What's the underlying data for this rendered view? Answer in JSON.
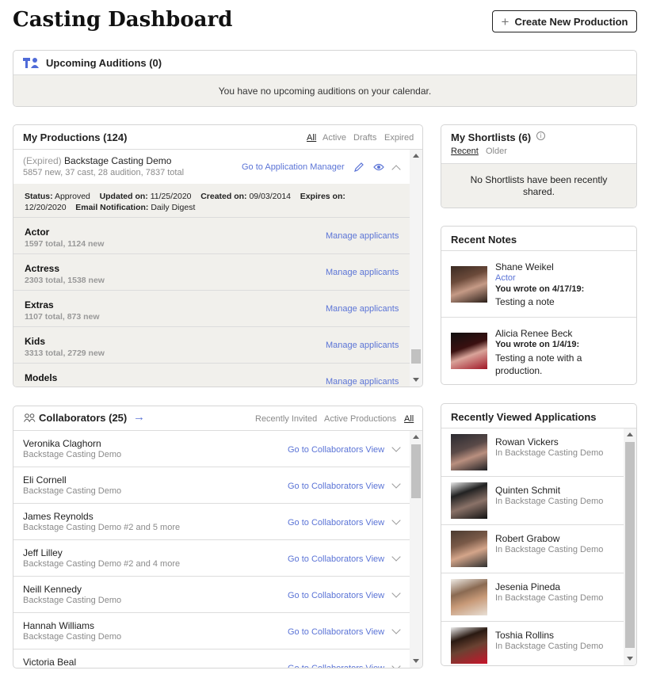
{
  "page": {
    "title": "Casting Dashboard",
    "create_btn": "Create New Production"
  },
  "auditions": {
    "title": "Upcoming Auditions (0)",
    "empty": "You have no upcoming auditions on your calendar."
  },
  "productions": {
    "title": "My Productions (124)",
    "filters": [
      "All",
      "Active",
      "Drafts",
      "Expired"
    ],
    "current": {
      "prefix": "(Expired)",
      "name": "Backstage Casting Demo",
      "stats": "5857 new, 37 cast, 28 audition, 7837 total",
      "app_link": "Go to Application Manager",
      "status_label": "Status:",
      "status": "Approved",
      "updated_label": "Updated on:",
      "updated": "11/25/2020",
      "created_label": "Created on:",
      "created": "09/03/2014",
      "expires_label": "Expires on:",
      "expires": "12/20/2020",
      "email_label": "Email Notification:",
      "email": "Daily Digest"
    },
    "roles": [
      {
        "name": "Actor",
        "stats": "1597 total, 1124 new",
        "link": "Manage applicants"
      },
      {
        "name": "Actress",
        "stats": "2303 total, 1538 new",
        "link": "Manage applicants"
      },
      {
        "name": "Extras",
        "stats": "1107 total, 873 new",
        "link": "Manage applicants"
      },
      {
        "name": "Kids",
        "stats": "3313 total, 2729 new",
        "link": "Manage applicants"
      },
      {
        "name": "Models",
        "stats": "",
        "link": "Manage applicants"
      }
    ]
  },
  "collaborators": {
    "title": "Collaborators (25)",
    "filters": [
      "Recently Invited",
      "Active Productions",
      "All"
    ],
    "items": [
      {
        "name": "Veronika Claghorn",
        "sub": "Backstage Casting Demo",
        "link": "Go to Collaborators View"
      },
      {
        "name": "Eli Cornell",
        "sub": "Backstage Casting Demo",
        "link": "Go to Collaborators View"
      },
      {
        "name": "James Reynolds",
        "sub": "Backstage Casting Demo #2 and 5 more",
        "link": "Go to Collaborators View"
      },
      {
        "name": "Jeff Lilley",
        "sub": "Backstage Casting Demo #2 and 4 more",
        "link": "Go to Collaborators View"
      },
      {
        "name": "Neill Kennedy",
        "sub": "Backstage Casting Demo",
        "link": "Go to Collaborators View"
      },
      {
        "name": "Hannah Williams",
        "sub": "Backstage Casting Demo",
        "link": "Go to Collaborators View"
      },
      {
        "name": "Victoria Beal",
        "sub": "",
        "link": "Go to Collaborators View"
      }
    ]
  },
  "shortlists": {
    "title": "My Shortlists (6)",
    "tabs": [
      "Recent",
      "Older"
    ],
    "empty": "No Shortlists have been recently shared."
  },
  "notes": {
    "title": "Recent Notes",
    "items": [
      {
        "name": "Shane Weikel",
        "role": "Actor",
        "wrote": "You wrote on 4/17/19:",
        "text": "Testing a note"
      },
      {
        "name": "Alicia Renee Beck",
        "role": "",
        "wrote": "You wrote on 1/4/19:",
        "text": "Testing a note with a production."
      }
    ]
  },
  "recent_apps": {
    "title": "Recently Viewed Applications",
    "items": [
      {
        "name": "Rowan Vickers",
        "sub": "In Backstage Casting Demo"
      },
      {
        "name": "Quinten Schmit",
        "sub": "In Backstage Casting Demo"
      },
      {
        "name": "Robert Grabow",
        "sub": "In Backstage Casting Demo"
      },
      {
        "name": "Jesenia Pineda",
        "sub": "In Backstage Casting Demo"
      },
      {
        "name": "Toshia Rollins",
        "sub": "In Backstage Casting Demo"
      }
    ]
  }
}
